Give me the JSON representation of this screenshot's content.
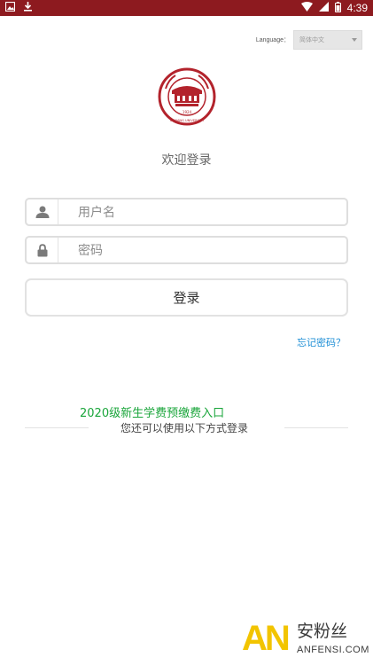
{
  "status_bar": {
    "time": "4:39",
    "left_icons": [
      "image-icon",
      "download-icon"
    ],
    "right_icons": [
      "wifi-icon",
      "signal-icon",
      "battery-icon"
    ],
    "bg_color": "#8d1a1f"
  },
  "language": {
    "label": "Language：",
    "selected": "简体中文"
  },
  "logo": {
    "text_top": "XINJIANG UNIVERSITY",
    "year": "1924",
    "primary_color": "#b3232c"
  },
  "welcome": "欢迎登录",
  "form": {
    "username_placeholder": "用户名",
    "password_placeholder": "密码",
    "login_label": "登录",
    "forgot_label": "忘记密码？"
  },
  "links": {
    "freshman_payment": "2020级新生学费预缴费入口",
    "other_methods": "您还可以使用以下方式登录"
  },
  "watermark": {
    "brand": "AN",
    "cn": "安粉丝",
    "en": "ANFENSI.COM"
  }
}
